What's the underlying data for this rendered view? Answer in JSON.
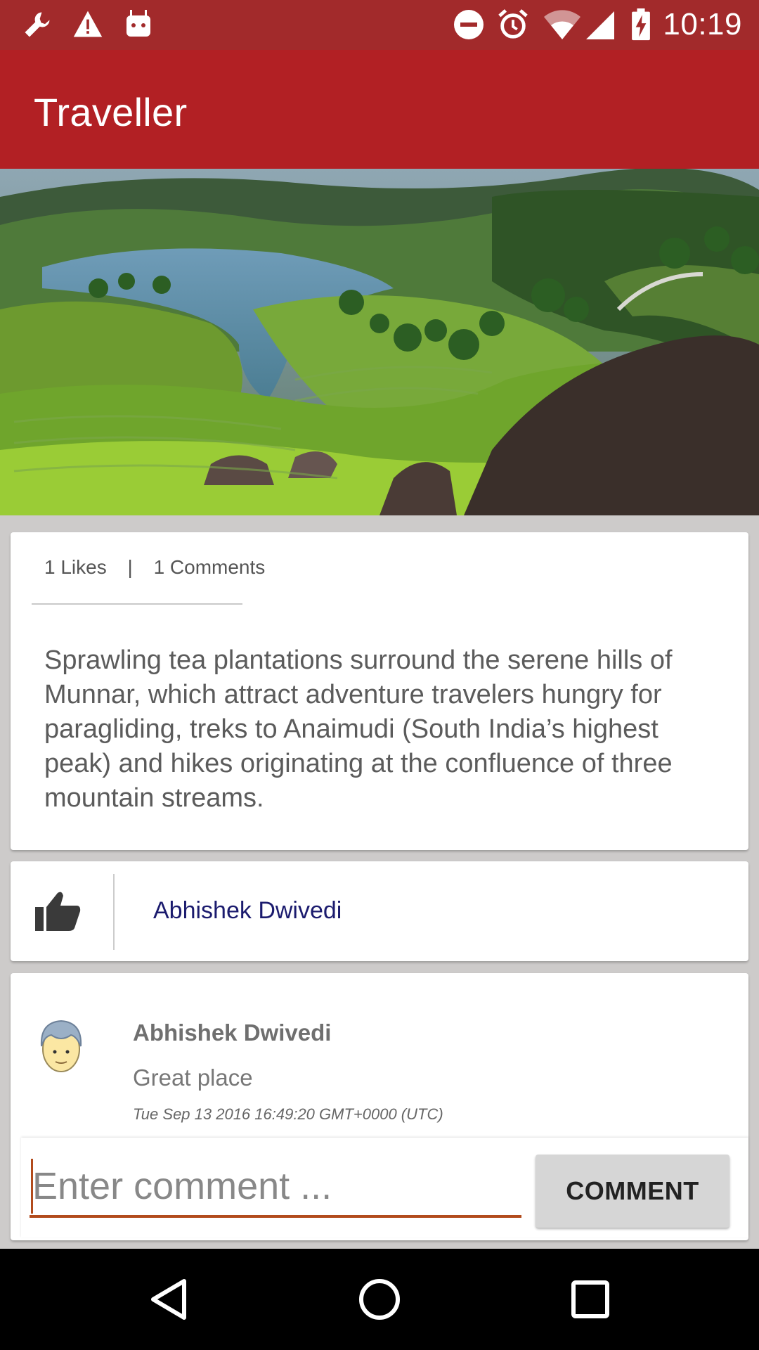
{
  "status_bar": {
    "time": "10:19",
    "icons": [
      "wrench-icon",
      "warning-icon",
      "android-debug-icon",
      "do-not-disturb-icon",
      "alarm-icon",
      "wifi-icon",
      "signal-icon",
      "battery-charging-icon"
    ]
  },
  "app_bar": {
    "title": "Traveller"
  },
  "hero": {
    "image": "Munnar tea plantations landscape"
  },
  "post": {
    "likes_label": "1 Likes",
    "separator": "|",
    "comments_label": "1 Comments",
    "description": "Sprawling tea plantations surround the serene hills of Munnar, which attract adventure travelers hungry for paragliding, treks to Anaimudi (South India’s highest peak) and hikes originating at the confluence of three mountain streams."
  },
  "likes": {
    "icon": "thumbs-up-icon",
    "users": [
      "Abhishek Dwivedi"
    ]
  },
  "comments": [
    {
      "author": "Abhishek Dwivedi",
      "text": "Great place",
      "timestamp": "Tue Sep 13 2016 16:49:20 GMT+0000 (UTC)",
      "avatar": "avatar-icon"
    }
  ],
  "composer": {
    "placeholder": "Enter comment ...",
    "value": "",
    "button_label": "COMMENT"
  },
  "colors": {
    "status_bar": "#a22a2b",
    "app_bar": "#b22024",
    "accent": "#b24b1c",
    "liker_name": "#1b1b6e",
    "background": "#cdcbca"
  },
  "nav_bar": {
    "buttons": [
      "back-icon",
      "home-icon",
      "recents-icon"
    ]
  }
}
